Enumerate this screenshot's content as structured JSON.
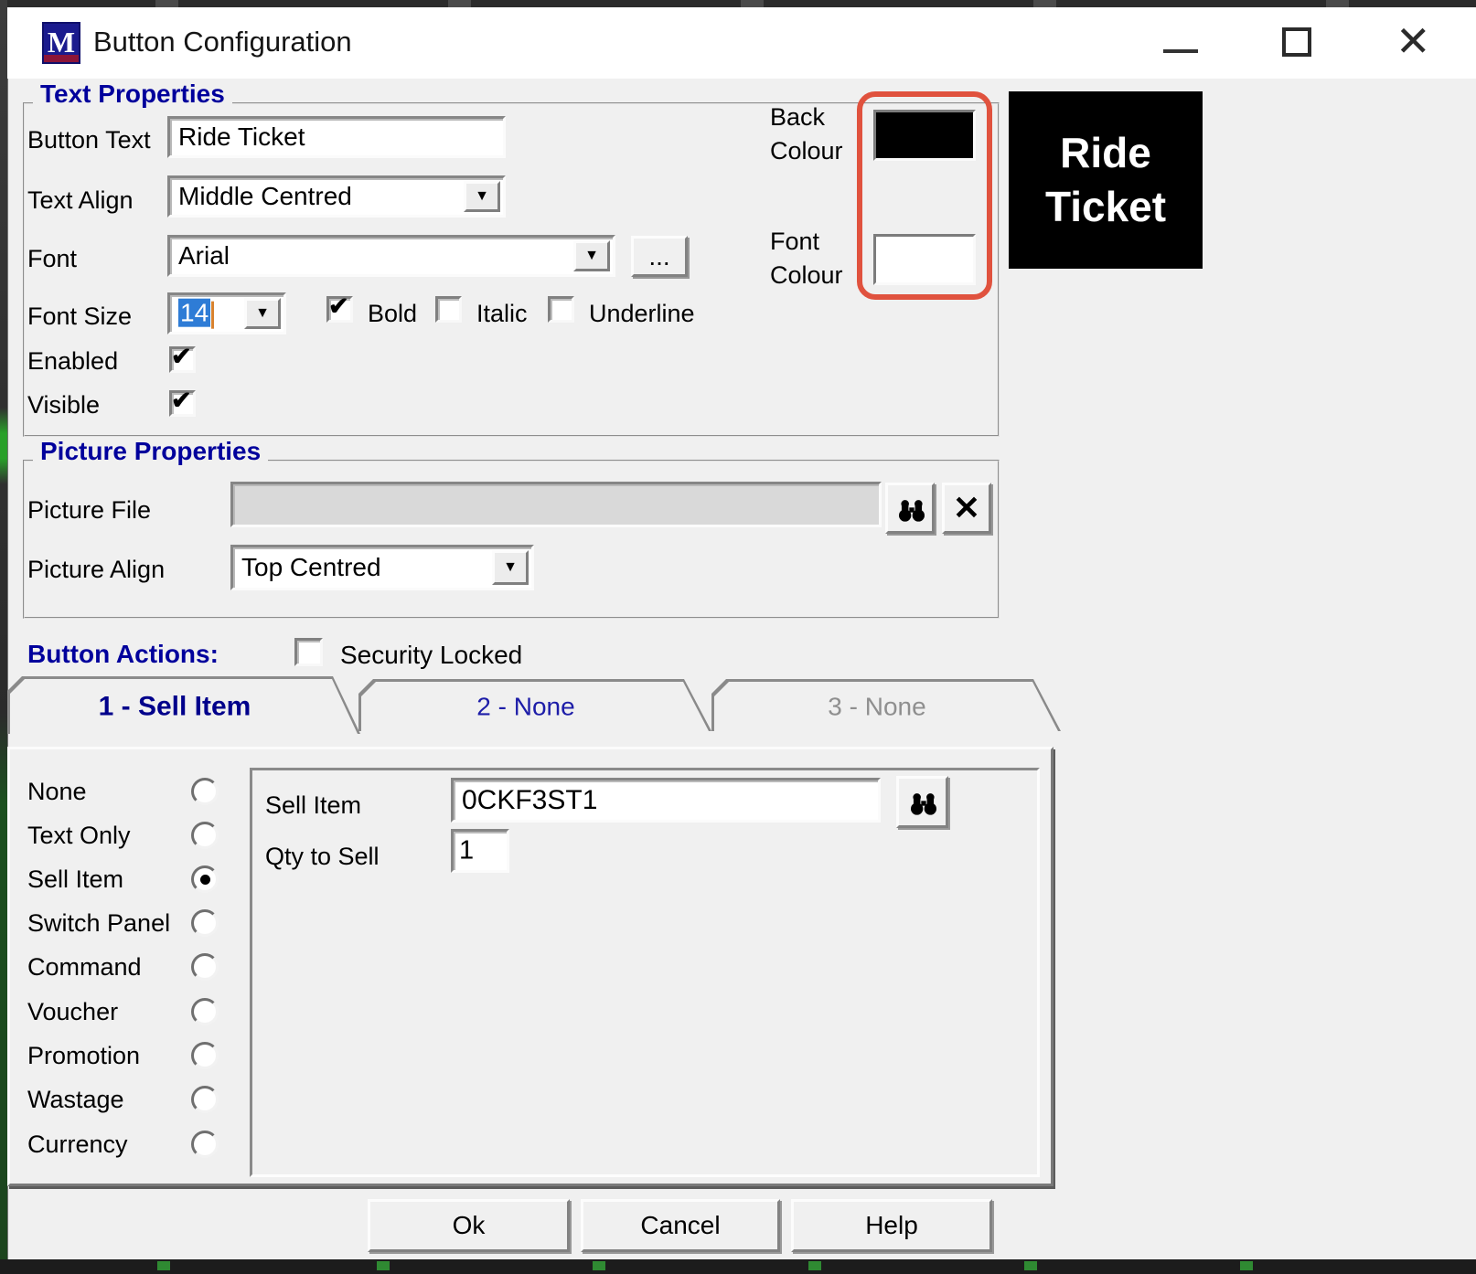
{
  "window": {
    "title": "Button Configuration",
    "icon_text": "M"
  },
  "icons": {
    "dropdown_arrow": "▼",
    "checkmark": "✔",
    "clear_x": "✕",
    "close": "✕"
  },
  "text_properties": {
    "group_title": "Text Properties",
    "button_text_label": "Button Text",
    "button_text_value": "Ride Ticket",
    "text_align_label": "Text Align",
    "text_align_value": "Middle Centred",
    "font_label": "Font",
    "font_value": "Arial",
    "font_browse_label": "...",
    "font_size_label": "Font Size",
    "font_size_value": "14",
    "bold_label": "Bold",
    "italic_label": "Italic",
    "underline_label": "Underline",
    "enabled_label": "Enabled",
    "visible_label": "Visible",
    "back_colour_label": "Back\nColour",
    "font_colour_label": "Font\nColour",
    "back_colour_value": "#000000",
    "font_colour_value": "#ffffff",
    "preview_text": "Ride\nTicket"
  },
  "picture_properties": {
    "group_title": "Picture Properties",
    "picture_file_label": "Picture File",
    "picture_file_value": "",
    "picture_align_label": "Picture Align",
    "picture_align_value": "Top Centred"
  },
  "button_actions": {
    "label": "Button Actions:",
    "security_label": "Security Locked",
    "tabs": [
      {
        "label": "1 - Sell Item",
        "state": "active"
      },
      {
        "label": "2 - None",
        "state": "normal"
      },
      {
        "label": "3 - None",
        "state": "disabled"
      }
    ],
    "options": [
      {
        "label": "None",
        "selected": false
      },
      {
        "label": "Text Only",
        "selected": false
      },
      {
        "label": "Sell Item",
        "selected": true
      },
      {
        "label": "Switch Panel",
        "selected": false
      },
      {
        "label": "Command",
        "selected": false
      },
      {
        "label": "Voucher",
        "selected": false
      },
      {
        "label": "Promotion",
        "selected": false
      },
      {
        "label": "Wastage",
        "selected": false
      },
      {
        "label": "Currency",
        "selected": false
      }
    ],
    "sell_item_label": "Sell Item",
    "sell_item_value": "0CKF3ST1",
    "qty_label": "Qty to Sell",
    "qty_value": "1"
  },
  "footer": {
    "ok": "Ok",
    "cancel": "Cancel",
    "help": "Help"
  },
  "colors": {
    "annotation_red": "#e0523e",
    "accent_navy": "#00009c",
    "preview_bg": "#000000",
    "preview_fg": "#ffffff"
  },
  "styles": {
    "back_swatch": "background:#000000",
    "font_swatch": "background:#ffffff",
    "preview": "background:#000000;color:#ffffff"
  }
}
